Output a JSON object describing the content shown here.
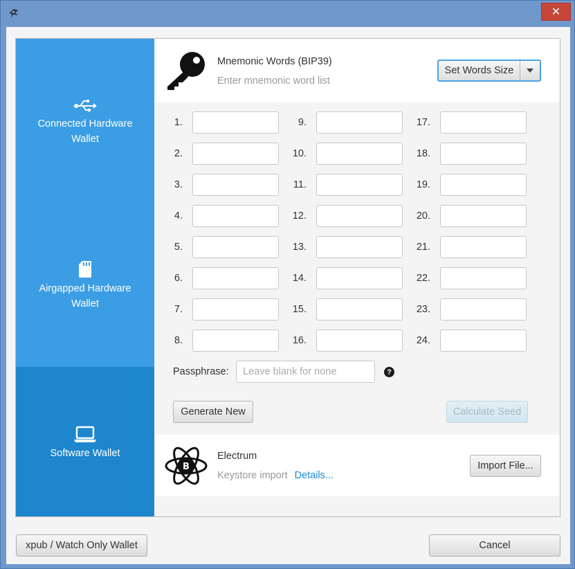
{
  "window": {
    "close_label": "✕"
  },
  "sidebar": {
    "items": [
      {
        "label": "Connected Hardware Wallet",
        "icon": "usb-icon"
      },
      {
        "label": "Airgapped Hardware Wallet",
        "icon": "sd-card-icon"
      },
      {
        "label": "Software Wallet",
        "icon": "laptop-icon",
        "active": true
      }
    ]
  },
  "mnemonic": {
    "title": "Mnemonic Words (BIP39)",
    "subtitle": "Enter mnemonic word list",
    "set_words_label": "Set Words Size",
    "word_numbers": [
      "1.",
      "2.",
      "3.",
      "4.",
      "5.",
      "6.",
      "7.",
      "8.",
      "9.",
      "10.",
      "11.",
      "12.",
      "13.",
      "14.",
      "15.",
      "16.",
      "17.",
      "18.",
      "19.",
      "20.",
      "21.",
      "22.",
      "23.",
      "24."
    ],
    "passphrase_label": "Passphrase:",
    "passphrase_placeholder": "Leave blank for none",
    "help_label": "?",
    "generate_label": "Generate New",
    "calculate_label": "Calculate Seed"
  },
  "electrum": {
    "title": "Electrum",
    "subtitle": "Keystore import",
    "details_label": "Details...",
    "import_label": "Import File...",
    "logo_letter": "B"
  },
  "footer": {
    "xpub_label": "xpub / Watch Only Wallet",
    "cancel_label": "Cancel"
  },
  "colors": {
    "sidebar": "#3b9de3",
    "sidebar_active": "#1d86cd",
    "focus": "#4aa3e6",
    "link": "#1f8ad4"
  }
}
